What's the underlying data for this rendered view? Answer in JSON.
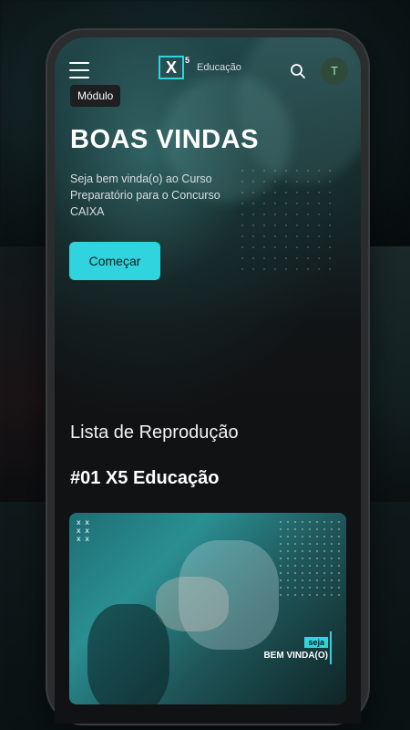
{
  "header": {
    "logo_mark": "X",
    "logo_sup": "5",
    "logo_text": "Educação",
    "avatar_initial": "T"
  },
  "hero": {
    "chip": "Módulo",
    "title": "BOAS VINDAS",
    "subtitle": "Seja bem vinda(o) ao Curso Preparatório para o Concurso CAIXA",
    "cta_label": "Começar"
  },
  "playlist": {
    "section_title": "Lista de Reprodução",
    "episode_title": "#01 X5 Educação",
    "thumb_badge_small": "seja",
    "thumb_badge_main": "BEM VINDA(O)",
    "thumb_marks": "x x\nx x\nx x"
  },
  "icons": {
    "menu": "menu-icon",
    "search": "search-icon"
  },
  "colors": {
    "accent": "#2fd4df",
    "background": "#111213",
    "avatar": "#2f4a3a"
  }
}
